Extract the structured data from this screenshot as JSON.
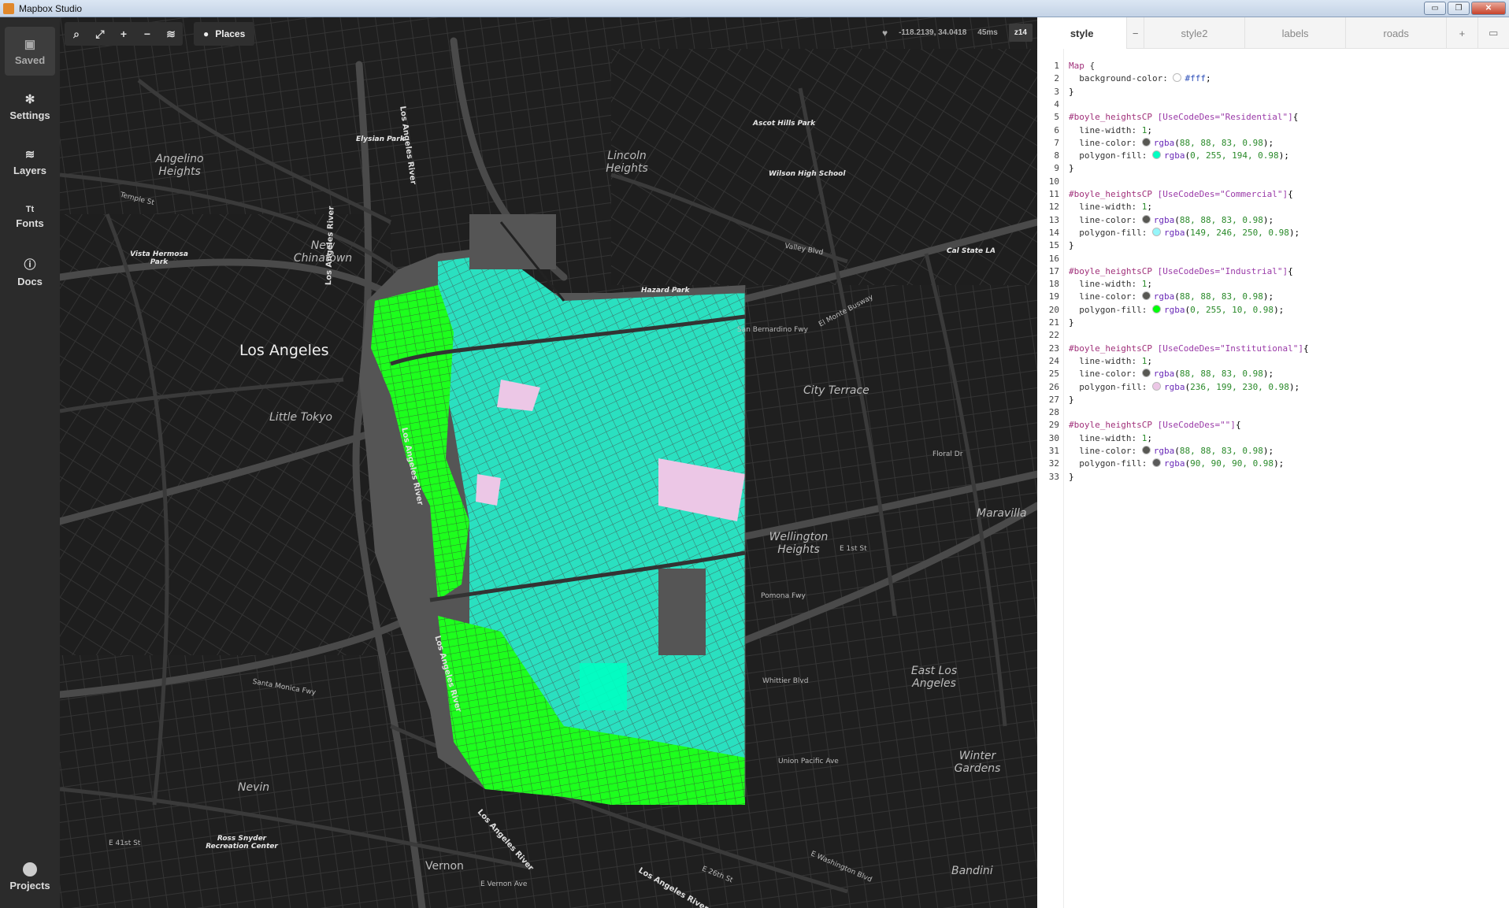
{
  "window": {
    "title": "Mapbox Studio",
    "controls": [
      "minimize",
      "restore",
      "close"
    ]
  },
  "sidebar": {
    "items": [
      {
        "label": "Saved",
        "icon": "save-icon"
      },
      {
        "label": "Settings",
        "icon": "gear-icon"
      },
      {
        "label": "Layers",
        "icon": "layers-icon"
      },
      {
        "label": "Fonts",
        "icon": "fonts-icon"
      },
      {
        "label": "Docs",
        "icon": "info-icon"
      }
    ],
    "projects_label": "Projects"
  },
  "map": {
    "toolbar": {
      "places_label": "Places",
      "buttons": [
        "search-icon",
        "fullscreen-icon",
        "zoom-in-icon",
        "zoom-out-icon",
        "layers-inspect-icon"
      ]
    },
    "status": {
      "coords": "-118.2139, 34.0418",
      "render_time": "45ms",
      "zoom": "z14"
    },
    "labels": {
      "los_angeles": "Los Angeles",
      "little_tokyo": "Little Tokyo",
      "angelino_heights": "Angelino Heights",
      "new_chinatown": "New Chinatown",
      "lincoln_heights": "Lincoln Heights",
      "city_terrace": "City Terrace",
      "wellington_heights": "Wellington Heights",
      "maravilla": "Maravilla",
      "east_los_angeles": "East Los Angeles",
      "winter_gardens": "Winter Gardens",
      "nevin": "Nevin",
      "vernon": "Vernon",
      "bandini": "Bandini",
      "elysian_park": "Elysian Park",
      "vista_hermosa_park": "Vista Hermosa Park",
      "ascot_hills_park": "Ascot Hills Park",
      "wilson_high_school": "Wilson High School",
      "hazard_park": "Hazard Park",
      "cal_state_la": "Cal State LA",
      "ross_snyder": "Ross Snyder Recreation Center",
      "la_river_1": "Los Angeles River",
      "la_river_2": "Los Angeles River",
      "la_river_3": "Los Angeles River",
      "la_river_4": "Los Angeles River",
      "la_river_5": "Los Angeles River",
      "la_river_6": "Los Angeles River",
      "el_monte_busway": "El Monte Busway",
      "pomona_fwy": "Pomona Fwy",
      "san_bernardino_fwy": "San Bernardino Fwy",
      "santa_monica_fwy": "Santa Monica Fwy",
      "union_pacific_ave": "Union Pacific Ave",
      "whittier_blvd": "Whittier Blvd",
      "valley_blvd": "Valley Blvd",
      "floral_dr": "Floral Dr",
      "e_26th_st": "E 26th St",
      "e_washington_blvd": "E Washington Blvd",
      "e_vernon_ave": "E Vernon Ave",
      "e_41st_st": "E 41st St",
      "temple_st": "Temple St",
      "e_1st_st": "E 1st St"
    }
  },
  "editor": {
    "tabs": [
      {
        "label": "style",
        "active": true
      },
      {
        "label": "style2",
        "active": false
      },
      {
        "label": "labels",
        "active": false
      },
      {
        "label": "roads",
        "active": false
      }
    ],
    "tab_remove": "−",
    "tab_add": "+",
    "code": {
      "map_selector": "Map {",
      "background_prop": "background-color:",
      "background_val": "#fff",
      "rules": [
        {
          "selector": "#boyle_heightsCP",
          "filter": "[UseCodeDes=\"Residential\"]",
          "width": "1",
          "line_color": "rgba(88, 88, 83, 0.98)",
          "fill": "rgba(0, 255, 194, 0.98)",
          "fill_hex": "#00ffc2"
        },
        {
          "selector": "#boyle_heightsCP",
          "filter": "[UseCodeDes=\"Commercial\"]",
          "width": "1",
          "line_color": "rgba(88, 88, 83, 0.98)",
          "fill": "rgba(149, 246, 250, 0.98)",
          "fill_hex": "#95f6fa"
        },
        {
          "selector": "#boyle_heightsCP",
          "filter": "[UseCodeDes=\"Industrial\"]",
          "width": "1",
          "line_color": "rgba(88, 88, 83, 0.98)",
          "fill": "rgba(0, 255, 10, 0.98)",
          "fill_hex": "#00ff0a"
        },
        {
          "selector": "#boyle_heightsCP",
          "filter": "[UseCodeDes=\"Institutional\"]",
          "width": "1",
          "line_color": "rgba(88, 88, 83, 0.98)",
          "fill": "rgba(236, 199, 230, 0.98)",
          "fill_hex": "#ecc7e6"
        },
        {
          "selector": "#boyle_heightsCP",
          "filter": "[UseCodeDes=\"\"]",
          "width": "1",
          "line_color": "rgba(88, 88, 83, 0.98)",
          "fill": "rgba(90, 90, 90, 0.98)",
          "fill_hex": "#5a5a5a"
        }
      ],
      "line_count": 33
    }
  },
  "colors": {
    "residential": "#00ffc2",
    "commercial": "#95f6fa",
    "industrial": "#00ff0a",
    "institutional": "#ecc7e6",
    "unknown": "#5a5a5a",
    "line": "#585853",
    "sidebar_bg": "#2b2b2b",
    "map_bg": "#1e1e1e"
  }
}
